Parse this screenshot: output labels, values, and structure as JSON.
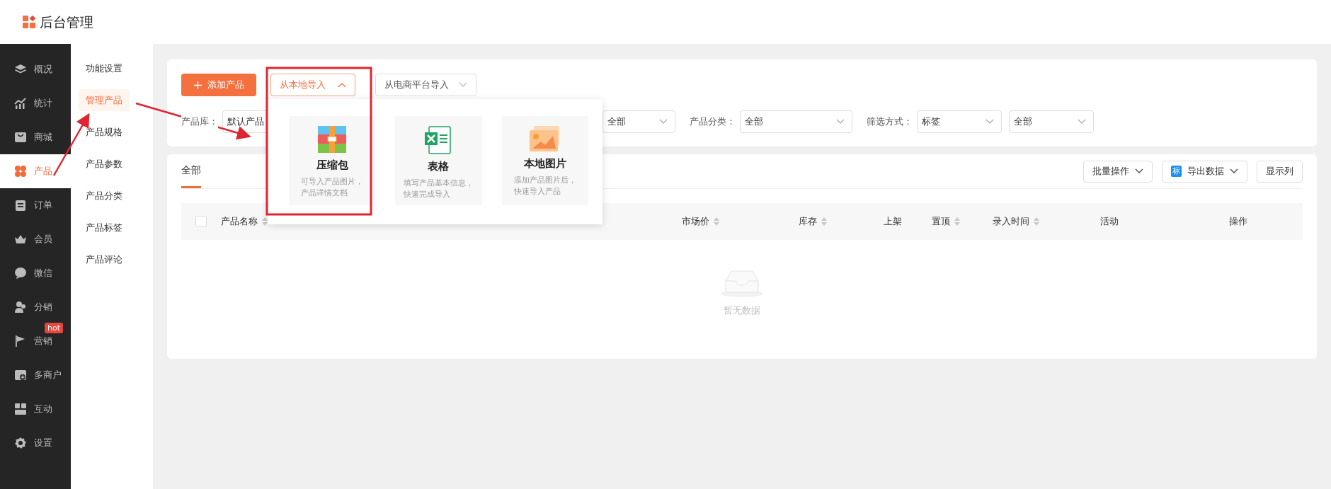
{
  "app": {
    "title": "后台管理"
  },
  "nav": [
    {
      "label": "概况",
      "selected": false
    },
    {
      "label": "统计",
      "selected": false
    },
    {
      "label": "商城",
      "selected": false
    },
    {
      "label": "产品",
      "selected": true
    },
    {
      "label": "订单",
      "selected": false
    },
    {
      "label": "会员",
      "selected": false
    },
    {
      "label": "微信",
      "selected": false
    },
    {
      "label": "分销",
      "selected": false
    },
    {
      "label": "营销",
      "selected": false,
      "badge": "hot"
    },
    {
      "label": "多商户",
      "selected": false
    },
    {
      "label": "互动",
      "selected": false
    },
    {
      "label": "设置",
      "selected": false
    }
  ],
  "subnav": [
    {
      "label": "功能设置",
      "selected": false
    },
    {
      "label": "管理产品",
      "selected": true
    },
    {
      "label": "产品规格",
      "selected": false
    },
    {
      "label": "产品参数",
      "selected": false
    },
    {
      "label": "产品分类",
      "selected": false
    },
    {
      "label": "产品标签",
      "selected": false
    },
    {
      "label": "产品评论",
      "selected": false
    }
  ],
  "toolbar": {
    "add_button": "添加产品",
    "import_menus": [
      {
        "label": "从本地导入",
        "expanded": true
      },
      {
        "label": "从电商平台导入",
        "expanded": false
      }
    ]
  },
  "filters": [
    {
      "label": "产品库：",
      "value": "默认产品"
    },
    {
      "value": "全部"
    },
    {
      "label": "产品分类：",
      "value": "全部"
    },
    {
      "label": "筛选方式：",
      "value": "标签"
    },
    {
      "value": "全部"
    }
  ],
  "import_popup": {
    "options": [
      {
        "kind": "zip",
        "title": "压缩包",
        "description_lines": [
          "可导入产品图片，",
          "产品详情文档"
        ]
      },
      {
        "kind": "sheet",
        "title": "表格",
        "description_lines": [
          "填写产品基本信息，",
          "快速完成导入"
        ]
      },
      {
        "kind": "image",
        "title": "本地图片",
        "description_lines": [
          "添加产品图片后，",
          "快速导入产品"
        ]
      }
    ]
  },
  "tabs": [
    {
      "label": "全部",
      "selected": true
    }
  ],
  "actions": [
    {
      "label": "批量操作",
      "caret": true
    },
    {
      "label": "导出数据",
      "badge": "标",
      "caret": true
    },
    {
      "label": "显示列"
    }
  ],
  "table": {
    "select_all_checked": false,
    "columns": [
      {
        "label": "产品名称",
        "sortable": true
      },
      {
        "label": "市场价",
        "sortable": true
      },
      {
        "label": "库存",
        "sortable": true
      },
      {
        "label": "上架",
        "sortable": false
      },
      {
        "label": "置顶",
        "sortable": true
      },
      {
        "label": "录入时间",
        "sortable": true
      },
      {
        "label": "活动",
        "sortable": false
      },
      {
        "label": "操作",
        "sortable": false
      }
    ],
    "empty_text": "暂无数据"
  }
}
